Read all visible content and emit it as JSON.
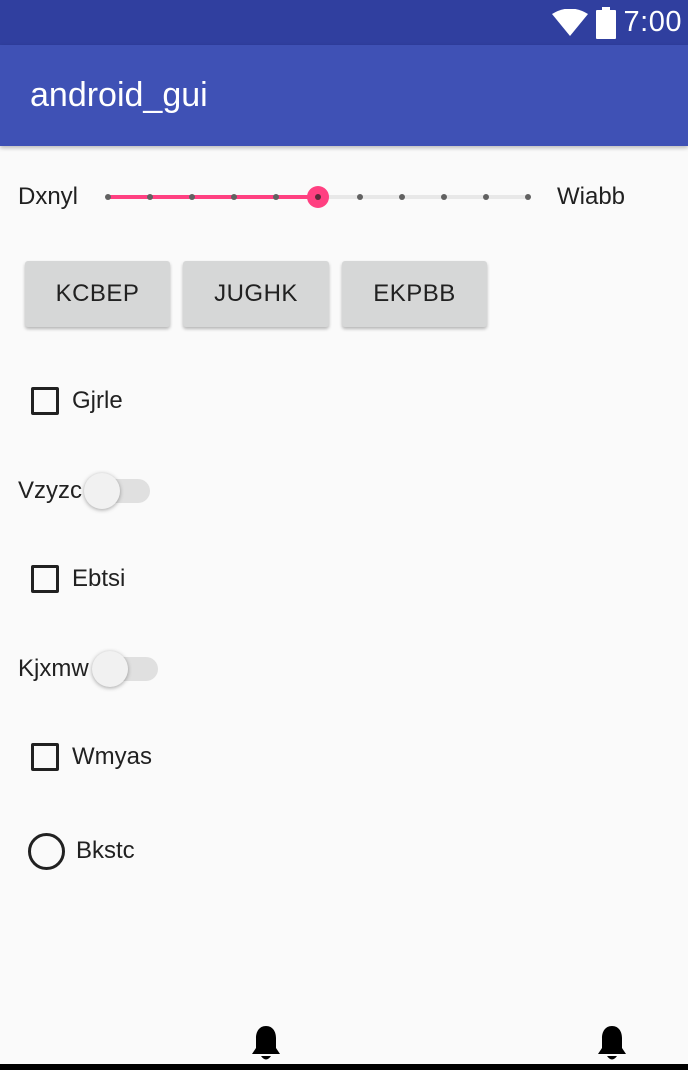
{
  "status_bar": {
    "time": "7:00",
    "icons": [
      "wifi-icon",
      "battery-icon"
    ],
    "color": "#303f9f"
  },
  "app_bar": {
    "title": "android_gui",
    "color": "#3f51b5"
  },
  "seekbar": {
    "left_label": "Dxnyl",
    "right_label": "Wiabb",
    "steps": 10,
    "value": 5,
    "accent_color": "#ff4081"
  },
  "buttons": [
    "KCBEP",
    "JUGHK",
    "EKPBB"
  ],
  "checkbox_1": {
    "label": "Gjrle",
    "checked": false
  },
  "switch_1": {
    "label": "Vzyzc",
    "on": false
  },
  "checkbox_2": {
    "label": "Ebtsi",
    "checked": false
  },
  "switch_2": {
    "label": "Kjxmw",
    "on": false
  },
  "checkbox_3": {
    "label": "Wmyas",
    "checked": false
  },
  "radio_1": {
    "label": "Bkstc",
    "checked": false
  },
  "bottom_icons": [
    "notification-bell-icon",
    "notification-bell-icon"
  ]
}
